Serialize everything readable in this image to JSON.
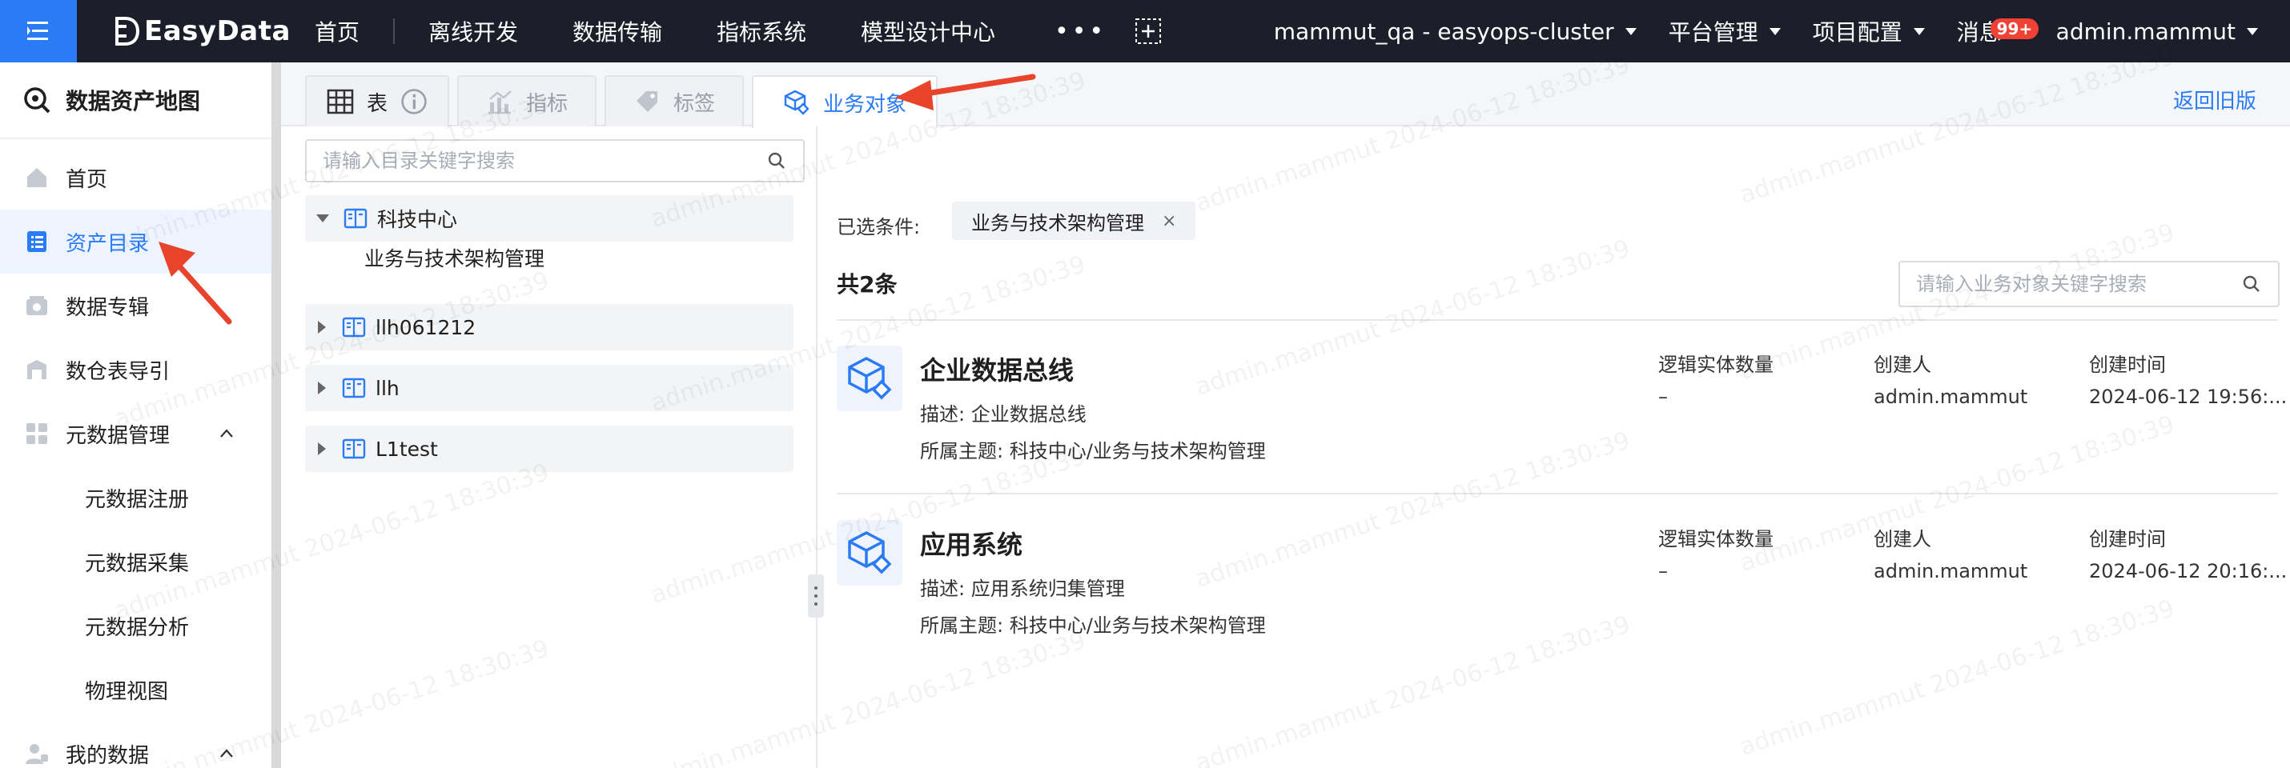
{
  "topbar": {
    "brand": "EasyData",
    "nav": [
      "首页",
      "离线开发",
      "数据传输",
      "指标系统",
      "模型设计中心"
    ],
    "more": "•••",
    "cluster": "mammut_qa - easyops-cluster",
    "platform": "平台管理",
    "project": "项目配置",
    "messages": "消息",
    "badge": "99+",
    "user": "admin.mammut"
  },
  "sidebar": {
    "title": "数据资产地图",
    "items": [
      {
        "label": "首页"
      },
      {
        "label": "资产目录"
      },
      {
        "label": "数据专辑"
      },
      {
        "label": "数仓表导引"
      },
      {
        "label": "元数据管理"
      },
      {
        "label": "元数据注册"
      },
      {
        "label": "元数据采集"
      },
      {
        "label": "元数据分析"
      },
      {
        "label": "物理视图"
      },
      {
        "label": "我的数据"
      }
    ]
  },
  "tabs": {
    "table": "表",
    "indicator": "指标",
    "tag": "标签",
    "business": "业务对象",
    "back": "返回旧版"
  },
  "tree": {
    "search_placeholder": "请输入目录关键字搜索",
    "nodes": [
      {
        "label": "科技中心",
        "child": "业务与技术架构管理"
      },
      {
        "label": "llh061212"
      },
      {
        "label": "llh"
      },
      {
        "label": "L1test"
      }
    ]
  },
  "filter": {
    "label": "已选条件:",
    "tag": "业务与技术架构管理",
    "remove": "×"
  },
  "count": "共2条",
  "obj_search_placeholder": "请输入业务对象关键字搜索",
  "columns": {
    "entity_count": "逻辑实体数量",
    "creator": "创建人",
    "created_at": "创建时间"
  },
  "objects": [
    {
      "title": "企业数据总线",
      "desc": "描述: 企业数据总线",
      "theme": "所属主题: 科技中心/业务与技术架构管理",
      "entity_count": "–",
      "creator": "admin.mammut",
      "created_at": "2024-06-12 19:56:..."
    },
    {
      "title": "应用系统",
      "desc": "描述: 应用系统归集管理",
      "theme": "所属主题: 科技中心/业务与技术架构管理",
      "entity_count": "–",
      "creator": "admin.mammut",
      "created_at": "2024-06-12 20:16:..."
    }
  ],
  "watermark": "admin.mammut 2024-06-12 18:30:39",
  "colors": {
    "accent": "#2a7bf6",
    "topbar": "#1c1f2a",
    "arrow": "#e8432b"
  }
}
